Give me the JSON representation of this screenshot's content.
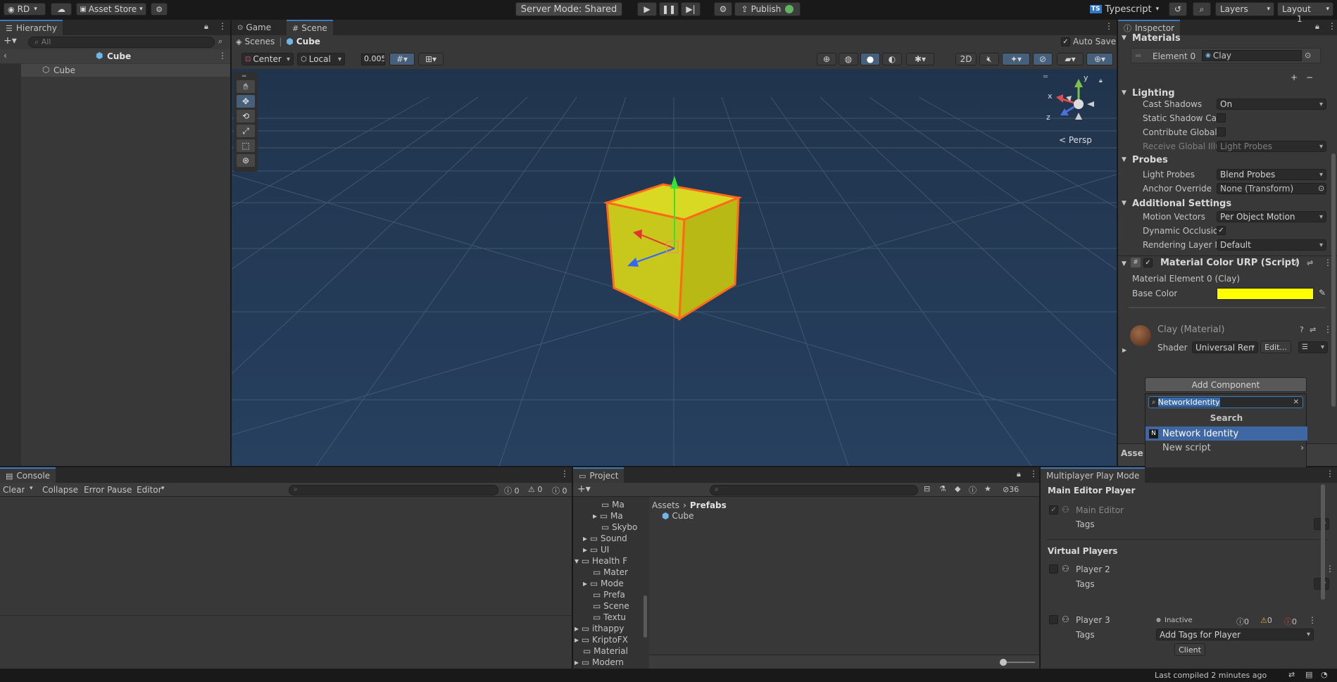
{
  "toolbar": {
    "account": "RD",
    "asset_store": "Asset Store",
    "server_mode": "Server Mode: Shared",
    "publish": "Publish",
    "language": "Typescript",
    "layers": "Layers",
    "layout": "Layout"
  },
  "hierarchy": {
    "tab": "Hierarchy",
    "search_placeholder": "All",
    "scene": "Cube",
    "item": "Cube"
  },
  "scene_view": {
    "tab_game": "Game",
    "tab_scene": "Scene",
    "breadcrumb_root": "Scenes",
    "breadcrumb_item": "Cube",
    "auto_save": "Auto Save",
    "pivot": "Center",
    "space": "Local",
    "snap": "0.005",
    "mode_2d": "2D",
    "persp": "< Persp",
    "gizmo_axes": {
      "y": "y",
      "x": "x",
      "z": "z"
    }
  },
  "inspector": {
    "tab": "Inspector",
    "materials": {
      "title": "Materials",
      "count": "1",
      "element_label": "Element 0",
      "element_value": "Clay"
    },
    "lighting": {
      "title": "Lighting",
      "rows": [
        {
          "label": "Cast Shadows",
          "value": "On"
        },
        {
          "label": "Static Shadow Cas",
          "value": ""
        },
        {
          "label": "Contribute Global",
          "value": ""
        },
        {
          "label": "Receive Global Illu",
          "value": "Light Probes"
        }
      ]
    },
    "probes": {
      "title": "Probes",
      "rows": [
        {
          "label": "Light Probes",
          "value": "Blend Probes"
        },
        {
          "label": "Anchor Override",
          "value": "None (Transform)"
        }
      ]
    },
    "additional": {
      "title": "Additional Settings",
      "rows": [
        {
          "label": "Motion Vectors",
          "value": "Per Object Motion"
        },
        {
          "label": "Dynamic Occlusio",
          "value": "✓"
        },
        {
          "label": "Rendering Layer M",
          "value": "Default"
        }
      ]
    },
    "script": {
      "title": "Material Color URP (Script)",
      "sub": "Material Element 0 (Clay)",
      "base_color_label": "Base Color",
      "base_color": "#ffff00"
    },
    "material": {
      "title": "Clay (Material)",
      "shader_label": "Shader",
      "shader_value": "Universal Ren",
      "edit": "Edit..."
    },
    "add_component": "Add Component",
    "search_value": "NetworkIdentity",
    "search_header": "Search",
    "results": [
      "Network Identity",
      "New script"
    ],
    "assets_peek": "Asse"
  },
  "console": {
    "tab": "Console",
    "clear": "Clear",
    "collapse": "Collapse",
    "error_pause": "Error Pause",
    "editor": "Editor",
    "counts": [
      "0",
      "0",
      "0"
    ]
  },
  "project": {
    "tab": "Project",
    "hidden_count": "36",
    "path_root": "Assets",
    "path_current": "Prefabs",
    "asset": "Cube",
    "tree": [
      "Ma",
      "Ma",
      "Skybo",
      "Sound",
      "UI",
      "Health F",
      "Mater",
      "Mode",
      "Prefa",
      "Scene",
      "Textu",
      "ithappy",
      "KriptoFX",
      "Material",
      "Modern"
    ]
  },
  "mppm": {
    "tab": "Multiplayer Play Mode",
    "main_header": "Main Editor Player",
    "main_editor": "Main Editor",
    "tags": "Tags",
    "virtual_header": "Virtual Players",
    "player2": "Player 2",
    "player3": "Player 3",
    "inactive": "Inactive",
    "counts": [
      "0",
      "0",
      "0"
    ],
    "add_tags": "Add Tags for Player",
    "client": "Client"
  },
  "status": {
    "last_compiled": "Last compiled 2 minutes ago"
  }
}
